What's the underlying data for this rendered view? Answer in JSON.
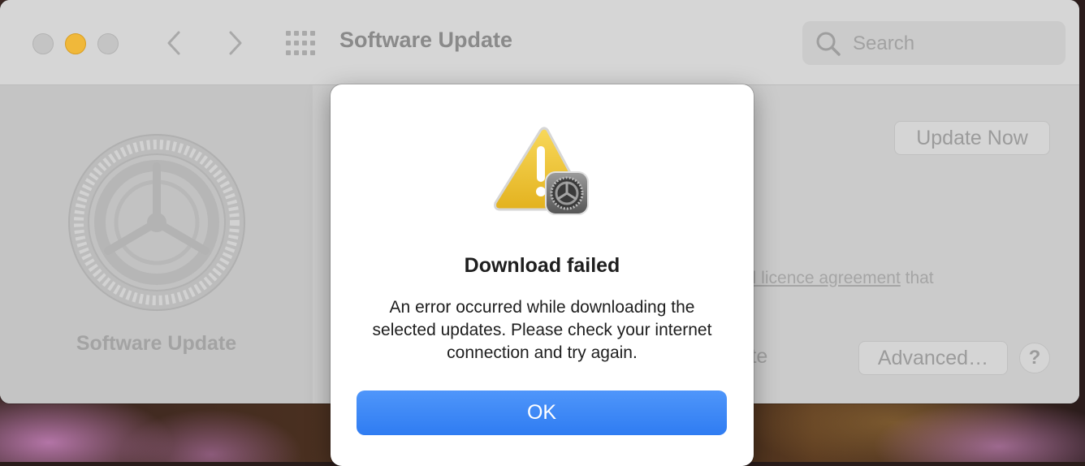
{
  "window": {
    "title": "Software Update",
    "search": {
      "placeholder": "Search",
      "value": ""
    }
  },
  "sidebar": {
    "label": "Software Update"
  },
  "content": {
    "update_now_label": "Update Now",
    "licence_link": "al licence agreement",
    "licence_after": " that",
    "partial_text": "late",
    "advanced_label": "Advanced…",
    "help_label": "?"
  },
  "dialog": {
    "title": "Download failed",
    "message": "An error occurred while downloading the selected updates. Please check your internet connection and try again.",
    "ok_label": "OK"
  },
  "colors": {
    "accent": "#3a86f7",
    "alert_yellow": "#f4c531",
    "minimize_yellow": "#f0b83a"
  }
}
